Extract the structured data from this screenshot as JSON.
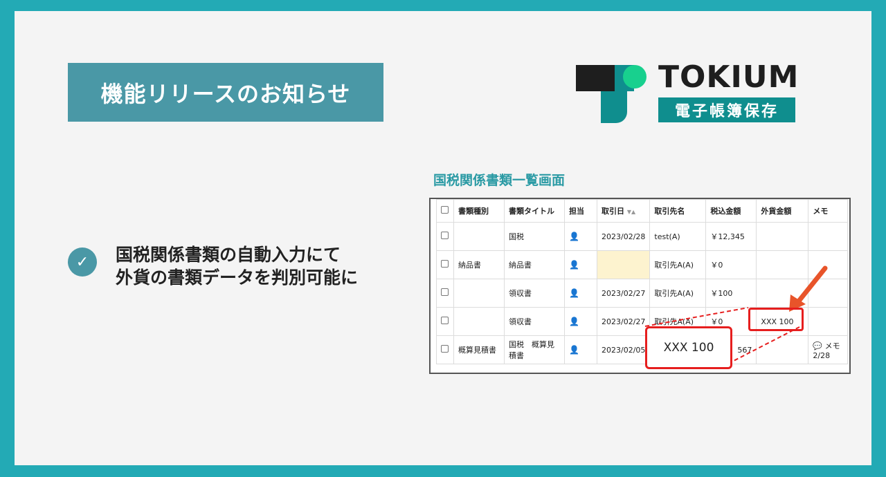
{
  "banner": {
    "title": "機能リリースのお知らせ"
  },
  "logo": {
    "word": "TOKIUM",
    "sub": "電子帳簿保存"
  },
  "feature": {
    "line1": "国税関係書類の自動入力にて",
    "line2": "外貨の書類データを判別可能に"
  },
  "screen_title": "国税関係書類一覧画面",
  "table": {
    "headers": [
      "書類種別",
      "書類タイトル",
      "担当",
      "取引日",
      "取引先名",
      "税込金額",
      "外貨金額",
      "メモ"
    ],
    "sort_indicator": "▼▲",
    "rows": [
      {
        "type": "",
        "title": "国税",
        "date": "2023/02/28",
        "partner": "test(A)",
        "amount": "￥12,345",
        "foreign": "",
        "memo": ""
      },
      {
        "type": "納品書",
        "title": "納品書",
        "date": "",
        "partner": "取引先A(A)",
        "amount": "￥0",
        "foreign": "",
        "memo": ""
      },
      {
        "type": "",
        "title": "領収書",
        "date": "2023/02/27",
        "partner": "取引先A(A)",
        "amount": "￥100",
        "foreign": "",
        "memo": ""
      },
      {
        "type": "",
        "title": "領収書",
        "date": "2023/02/27",
        "partner": "取引先A(A)",
        "amount": "￥0",
        "foreign": "XXX 100",
        "memo": ""
      },
      {
        "type": "概算見積書",
        "title": "国税　概算見積書",
        "date": "2023/02/05",
        "partner": "",
        "amount": "567",
        "foreign": "",
        "memo": "メモ 2/28"
      }
    ],
    "callout": "XXX 100"
  },
  "colors": {
    "accent": "#4a98a6",
    "frame": "#23aab5",
    "highlight": "#e61e1e",
    "brand": "#0f8e8e"
  }
}
